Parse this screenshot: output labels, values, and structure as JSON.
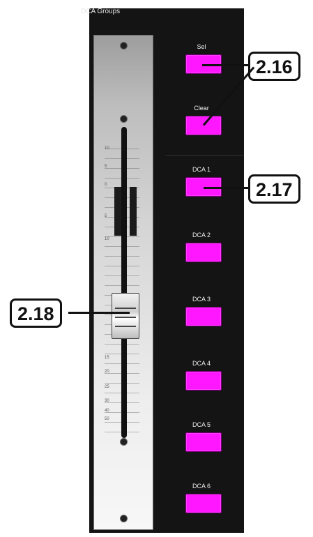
{
  "header": {
    "title": "DCA Groups"
  },
  "fader": {
    "scale_labels": [
      "10",
      "5",
      "0",
      "5",
      "10",
      "15",
      "20",
      "25",
      "30",
      "40",
      "50"
    ]
  },
  "buttons": [
    {
      "label": "Sel"
    },
    {
      "label": "Clear"
    },
    {
      "label": "DCA 1"
    },
    {
      "label": "DCA 2"
    },
    {
      "label": "DCA 3"
    },
    {
      "label": "DCA 4"
    },
    {
      "label": "DCA 5"
    },
    {
      "label": "DCA 6"
    }
  ],
  "callouts": {
    "c1": "2.16",
    "c2": "2.17",
    "c3": "2.18"
  },
  "colors": {
    "button": "#ff18ff",
    "panel": "#141414"
  }
}
